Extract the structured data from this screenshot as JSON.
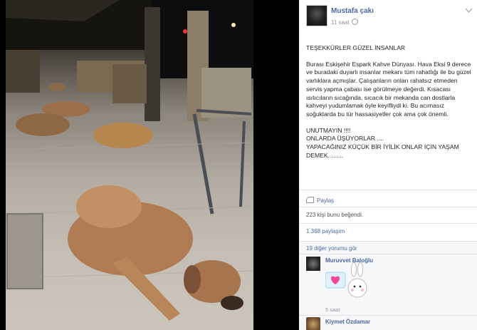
{
  "post": {
    "author": "Mustafa çakı",
    "time": "11 saat",
    "title": "TEŞEKKÜRLER GÜZEL İNSANLAR",
    "paragraph1": "Burası Eskişehir Espark Kahve Dünyası. Hava Eksi 9 derece ve buradaki duyarlı insanlar mekanı tüm rahatlığı ile bu güzel varlıklara açmışlar. Çalışanların onları rahatsız etmeden servis yapma çabası ise görülmeye değerdi. Kısacası ısıtıcıların sıcağında, sıcacık bir mekanda can dostlarla kahveyi yudumlamak öyle keyifliydi ki. Bu acımasız soğuklarda bu tür hassasiyetler çok ama çok önemli.",
    "line1": "UNUTMAYIN !!!!",
    "line2": "ONLARDA ÜŞÜYORLAR ....",
    "line3": "YAPACAĞINIZ KÜÇÜK BİR İYİLİK ONLAR İÇİN YAŞAM DEMEK........."
  },
  "actions": {
    "share_label": "Paylaş",
    "likes": "223 kişi bunu beğendi.",
    "shares": "1.368 paylaşım",
    "more_comments": "19 diğer yorumu gör"
  },
  "comments": [
    {
      "name": "Muruvvet Baloğlu",
      "time": "5 saat",
      "sticker": "bunny-heart-sticker"
    },
    {
      "name": "Kiymet Özdamar"
    }
  ],
  "colors": {
    "link": "#4b67a1",
    "meta": "#90949c",
    "background": "#000000"
  }
}
